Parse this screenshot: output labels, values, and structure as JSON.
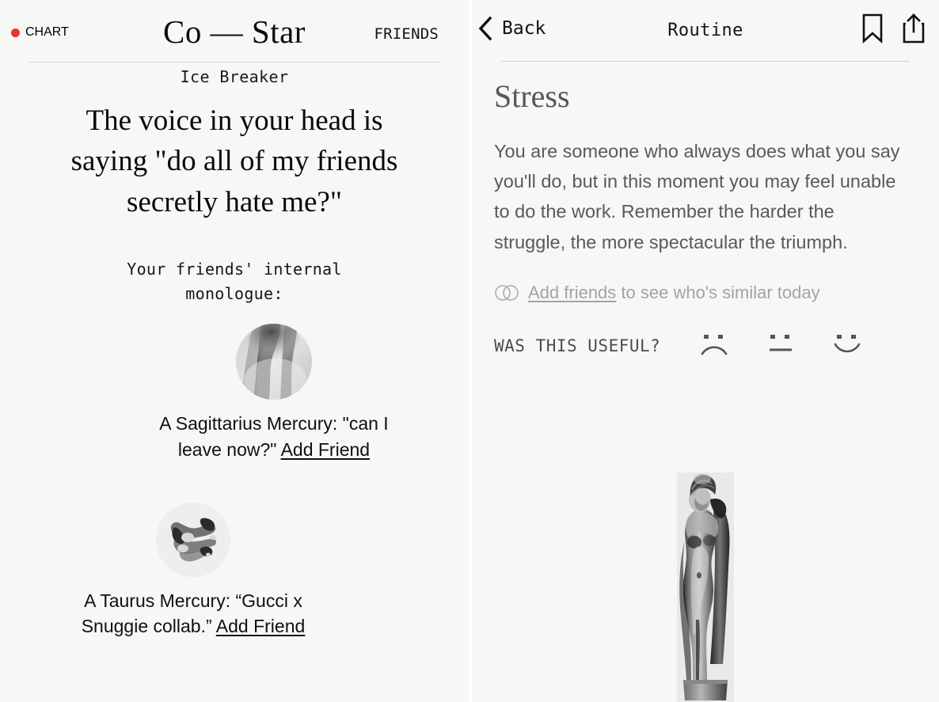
{
  "theme": {
    "page_background": "#f7f7f5",
    "accent_dot": "#e8342a",
    "text_primary": "#101010",
    "text_muted": "#59595a",
    "link_muted": "#a3a3a3",
    "divider": "#d2d2d2"
  },
  "left_panel": {
    "header": {
      "chart_tab": "CHART",
      "logo": "Co — Star",
      "friends_tab": "FRIENDS",
      "dot_icon": "red-dot-icon"
    },
    "section_label": "Ice Breaker",
    "quote": "The voice in your head is saying \"do all of my friends secretly hate me?\"",
    "monologue_label": "Your friends' internal monologue:",
    "friends": [
      {
        "avatar_icon": "avatar-photo-neck",
        "text": "A Sagittarius Mercury: \"can I leave now?\" ",
        "action_label": "Add Friend"
      },
      {
        "avatar_icon": "avatar-photo-hand",
        "text": "A Taurus Mercury: “Gucci x Snuggie collab.” ",
        "action_label": "Add Friend"
      }
    ]
  },
  "right_panel": {
    "header": {
      "back_label": "Back",
      "back_icon": "chevron-left-icon",
      "title": "Routine",
      "bookmark_icon": "bookmark-icon",
      "share_icon": "share-icon"
    },
    "heading": "Stress",
    "paragraph": "You are someone who always does what you say you'll do, but in this moment you may feel unable to do the work. Remember the harder the struggle, the more spectacular the triumph.",
    "add_friends": {
      "icon": "overlapping-circles-icon",
      "link_label": "Add friends",
      "suffix": " to see who's similar today"
    },
    "feedback": {
      "label": "WAS THIS USEFUL?",
      "options": [
        "sad-face-icon",
        "neutral-face-icon",
        "happy-face-icon"
      ]
    },
    "illustration": "classical-statue-image"
  }
}
